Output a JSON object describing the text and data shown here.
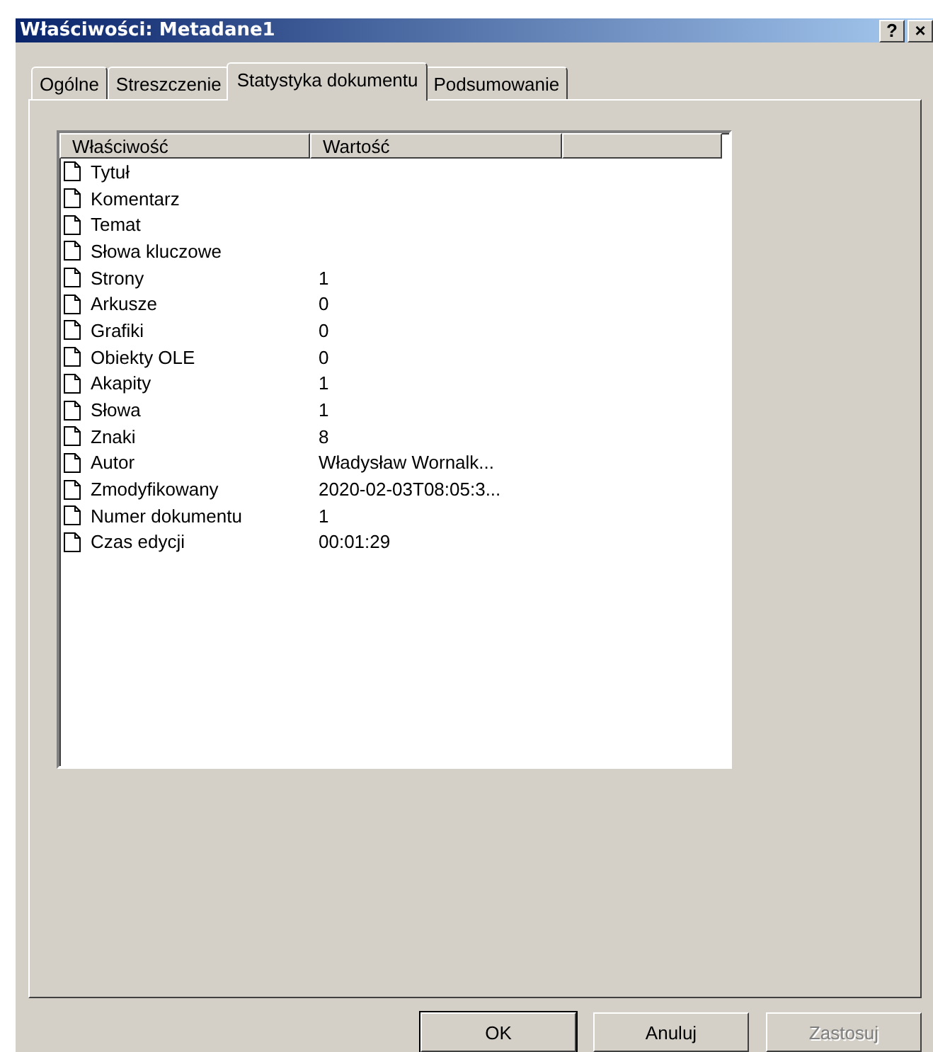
{
  "window": {
    "title": "Właściwości: Metadane1",
    "help_button": "?",
    "close_button": "×"
  },
  "tabs": [
    {
      "label": "Ogólne",
      "selected": false
    },
    {
      "label": "Streszczenie",
      "selected": false
    },
    {
      "label": "Statystyka dokumentu",
      "selected": true
    },
    {
      "label": "Podsumowanie",
      "selected": false
    }
  ],
  "table": {
    "columns": [
      "Właściwość",
      "Wartość"
    ],
    "rows": [
      {
        "property": "Tytuł",
        "value": ""
      },
      {
        "property": "Komentarz",
        "value": ""
      },
      {
        "property": "Temat",
        "value": ""
      },
      {
        "property": "Słowa kluczowe",
        "value": ""
      },
      {
        "property": "Strony",
        "value": "1"
      },
      {
        "property": "Arkusze",
        "value": "0"
      },
      {
        "property": "Grafiki",
        "value": "0"
      },
      {
        "property": "Obiekty OLE",
        "value": "0"
      },
      {
        "property": "Akapity",
        "value": "1"
      },
      {
        "property": "Słowa",
        "value": "1"
      },
      {
        "property": "Znaki",
        "value": "8"
      },
      {
        "property": "Autor",
        "value": "Władysław Wornalk..."
      },
      {
        "property": "Zmodyfikowany",
        "value": "2020-02-03T08:05:3..."
      },
      {
        "property": "Numer dokumentu",
        "value": "1"
      },
      {
        "property": "Czas edycji",
        "value": "00:01:29"
      }
    ]
  },
  "buttons": [
    {
      "label": "OK",
      "disabled": false,
      "default": true
    },
    {
      "label": "Anuluj",
      "disabled": false,
      "default": false
    },
    {
      "label": "Zastosuj",
      "disabled": true,
      "default": false
    }
  ]
}
